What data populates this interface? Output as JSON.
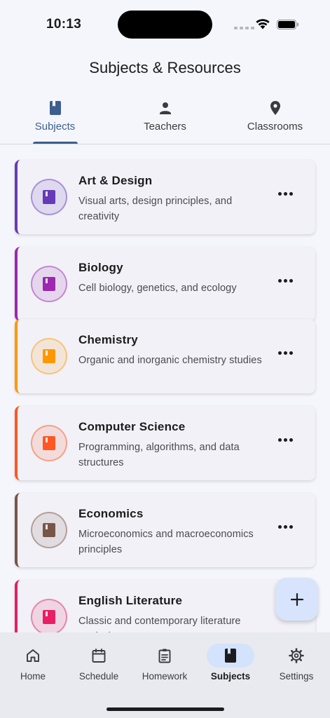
{
  "status_bar": {
    "time": "10:13"
  },
  "header": {
    "title": "Subjects & Resources"
  },
  "tabs": [
    {
      "label": "Subjects",
      "icon": "book-icon",
      "active": true
    },
    {
      "label": "Teachers",
      "icon": "person-icon",
      "active": false
    },
    {
      "label": "Classrooms",
      "icon": "location-pin-icon",
      "active": false
    }
  ],
  "subjects": [
    {
      "name": "Art & Design",
      "description": "Visual arts, design principles, and creativity",
      "color": "#673ab7"
    },
    {
      "name": "Biology",
      "description": "Cell biology, genetics, and ecology",
      "color": "#9c27b0"
    },
    {
      "name": "Chemistry",
      "description": "Organic and inorganic chemistry studies",
      "color": "#ff9800"
    },
    {
      "name": "Computer Science",
      "description": "Programming, algorithms, and data structures",
      "color": "#ff5722"
    },
    {
      "name": "Economics",
      "description": "Microeconomics and macroeconomics principles",
      "color": "#795548"
    },
    {
      "name": "English Literature",
      "description": "Classic and contemporary literature analysis",
      "color": "#e91e63"
    }
  ],
  "fab": {
    "icon": "plus-icon"
  },
  "bottom_nav": [
    {
      "label": "Home",
      "icon": "home-icon",
      "active": false
    },
    {
      "label": "Schedule",
      "icon": "calendar-icon",
      "active": false
    },
    {
      "label": "Homework",
      "icon": "clipboard-icon",
      "active": false
    },
    {
      "label": "Subjects",
      "icon": "book-icon",
      "active": true
    },
    {
      "label": "Settings",
      "icon": "gear-icon",
      "active": false
    }
  ]
}
